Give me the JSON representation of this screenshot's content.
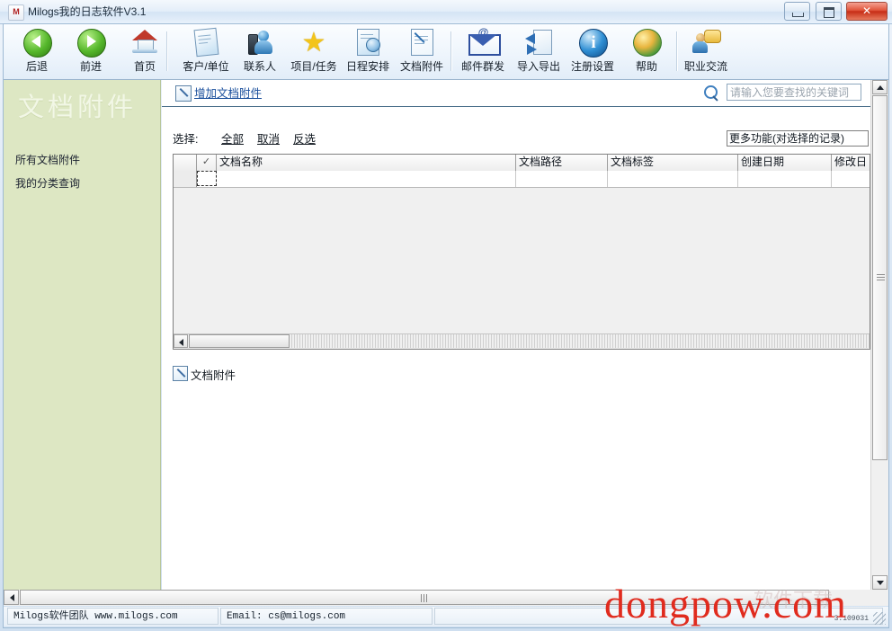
{
  "window": {
    "title": "Milogs我的日志软件V3.1",
    "icon": "app-logo-icon",
    "minimize_label": "",
    "maximize_label": "",
    "close_label": "✕"
  },
  "toolbar": {
    "items": [
      {
        "label": "后退",
        "icon": "back-arrow-icon"
      },
      {
        "label": "前进",
        "icon": "forward-arrow-icon"
      },
      {
        "label": "首页",
        "icon": "home-icon"
      },
      {
        "label": "客户/单位",
        "icon": "customer-icon"
      },
      {
        "label": "联系人",
        "icon": "contact-person-icon"
      },
      {
        "label": "项目/任务",
        "icon": "star-project-icon"
      },
      {
        "label": "日程安排",
        "icon": "schedule-clock-icon"
      },
      {
        "label": "文档附件",
        "icon": "document-attachment-icon"
      },
      {
        "label": "邮件群发",
        "icon": "mass-mail-icon"
      },
      {
        "label": "导入导出",
        "icon": "import-export-icon"
      },
      {
        "label": "注册设置",
        "icon": "info-register-icon"
      },
      {
        "label": "帮助",
        "icon": "help-globe-icon"
      },
      {
        "label": "职业交流",
        "icon": "career-exchange-icon"
      }
    ]
  },
  "sidebar": {
    "watermark": "文档附件",
    "items": [
      {
        "label": "所有文档附件"
      },
      {
        "label": "我的分类查询"
      }
    ]
  },
  "main": {
    "add_link": "增加文档附件",
    "add_link_icon": "edit-document-icon",
    "search": {
      "icon": "search-icon",
      "placeholder": "请输入您要查找的关键词",
      "value": ""
    },
    "selection": {
      "label": "选择:",
      "all": "全部",
      "cancel": "取消",
      "invert": "反选"
    },
    "more_actions": {
      "selected": "更多功能(对选择的记录)"
    },
    "grid": {
      "check_header": "✓",
      "columns": [
        "文档名称",
        "文档路径",
        "文档标签",
        "创建日期",
        "修改日"
      ],
      "rows": []
    },
    "footer_label": "文档附件",
    "footer_icon": "edit-document-icon"
  },
  "statusbar": {
    "left": "Milogs软件团队   www.milogs.com",
    "middle": "Email:  cs@milogs.com",
    "right": "",
    "version": "3.109031"
  },
  "watermark": {
    "text": "dongpow.com",
    "faint": "软件下载"
  },
  "colors": {
    "sidebar_bg": "#dde7c3",
    "link": "#1a4f9c",
    "watermark_red": "#e02b1e",
    "titlebar": "#e4eef9"
  }
}
